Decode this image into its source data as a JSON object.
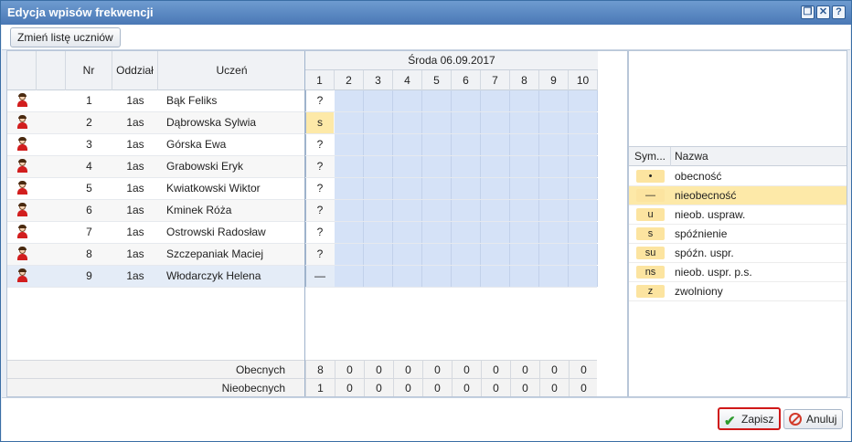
{
  "window": {
    "title": "Edycja wpisów frekwencji",
    "controls": [
      "restore-icon",
      "close-icon",
      "help-icon"
    ],
    "accent": "#4a78b5"
  },
  "toolbar": {
    "change_list_label": "Zmień listę uczniów"
  },
  "grid": {
    "columns": {
      "nr": "Nr",
      "class": "Oddział",
      "student": "Uczeń"
    },
    "date": "Środa 06.09.2017",
    "lessons": [
      "1",
      "2",
      "3",
      "4",
      "5",
      "6",
      "7",
      "8",
      "9",
      "10"
    ],
    "rows": [
      {
        "nr": "1",
        "class": "1as",
        "name": "Bąk Feliks",
        "mark": "?"
      },
      {
        "nr": "2",
        "class": "1as",
        "name": "Dąbrowska Sylwia",
        "mark": "s"
      },
      {
        "nr": "3",
        "class": "1as",
        "name": "Górska Ewa",
        "mark": "?"
      },
      {
        "nr": "4",
        "class": "1as",
        "name": "Grabowski Eryk",
        "mark": "?"
      },
      {
        "nr": "5",
        "class": "1as",
        "name": "Kwiatkowski Wiktor",
        "mark": "?"
      },
      {
        "nr": "6",
        "class": "1as",
        "name": "Kminek Róża",
        "mark": "?"
      },
      {
        "nr": "7",
        "class": "1as",
        "name": "Ostrowski Radosław",
        "mark": "?"
      },
      {
        "nr": "8",
        "class": "1as",
        "name": "Szczepaniak Maciej",
        "mark": "?"
      },
      {
        "nr": "9",
        "class": "1as",
        "name": "Włodarczyk Helena",
        "mark": "—"
      }
    ],
    "totals": [
      {
        "label": "Obecnych",
        "values": [
          "8",
          "0",
          "0",
          "0",
          "0",
          "0",
          "0",
          "0",
          "0",
          "0"
        ]
      },
      {
        "label": "Nieobecnych",
        "values": [
          "1",
          "0",
          "0",
          "0",
          "0",
          "0",
          "0",
          "0",
          "0",
          "0"
        ]
      }
    ]
  },
  "legend": {
    "headers": {
      "symbol": "Sym...",
      "name": "Nazwa"
    },
    "items": [
      {
        "symbol": "•",
        "name": "obecność"
      },
      {
        "symbol": "—",
        "name": "nieobecność"
      },
      {
        "symbol": "u",
        "name": "nieob. uspraw."
      },
      {
        "symbol": "s",
        "name": "spóźnienie"
      },
      {
        "symbol": "su",
        "name": "spóźn. uspr."
      },
      {
        "symbol": "ns",
        "name": "nieob. uspr. p.s."
      },
      {
        "symbol": "z",
        "name": "zwolniony"
      }
    ]
  },
  "footer": {
    "save_label": "Zapisz",
    "cancel_label": "Anuluj"
  }
}
